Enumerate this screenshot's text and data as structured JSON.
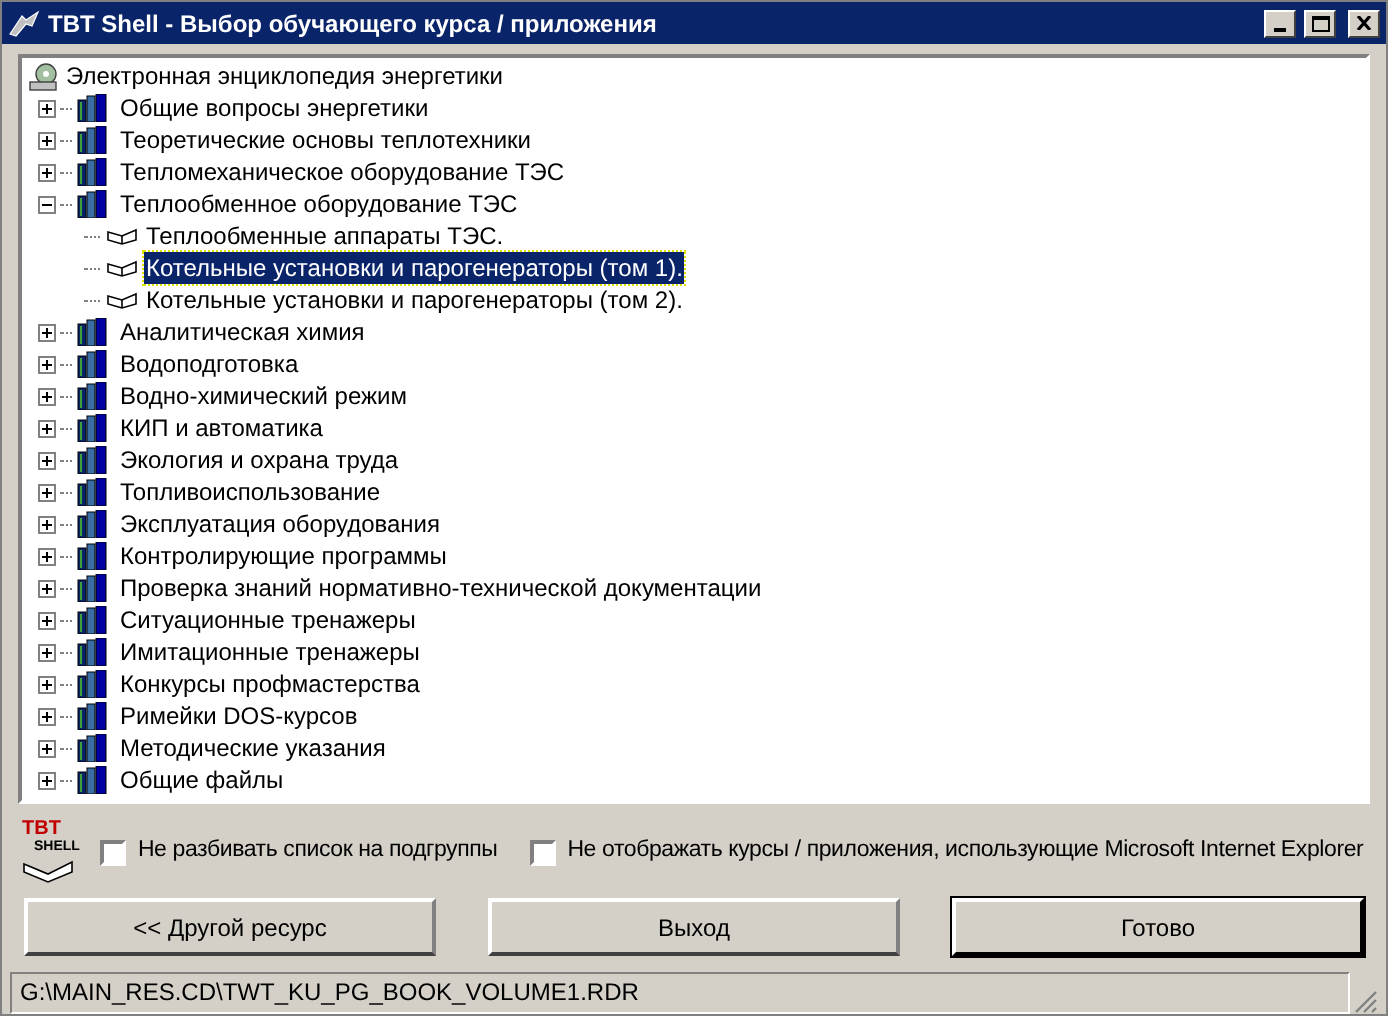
{
  "window": {
    "title": "TBT Shell - Выбор обучающего курса / приложения"
  },
  "tree": {
    "label": "Электронная энциклопедия энергетики",
    "children": [
      {
        "label": "Общие вопросы энергетики",
        "expanded": false
      },
      {
        "label": "Теоретические основы теплотехники",
        "expanded": false
      },
      {
        "label": "Тепломеханическое оборудование ТЭС",
        "expanded": false
      },
      {
        "label": "Теплообменное оборудование ТЭС",
        "expanded": true,
        "children": [
          {
            "label": "Теплообменные аппараты ТЭС.",
            "selected": false
          },
          {
            "label": "Котельные установки и парогенераторы (том 1).",
            "selected": true
          },
          {
            "label": "Котельные установки и парогенераторы (том 2).",
            "selected": false
          }
        ]
      },
      {
        "label": "Аналитическая химия",
        "expanded": false
      },
      {
        "label": "Водоподготовка",
        "expanded": false
      },
      {
        "label": "Водно-химический режим",
        "expanded": false
      },
      {
        "label": "КИП и автоматика",
        "expanded": false
      },
      {
        "label": "Экология и охрана труда",
        "expanded": false
      },
      {
        "label": "Топливоиспользование",
        "expanded": false
      },
      {
        "label": "Эксплуатация оборудования",
        "expanded": false
      },
      {
        "label": "Контролирующие программы",
        "expanded": false
      },
      {
        "label": "Проверка знаний нормативно-технической документации",
        "expanded": false
      },
      {
        "label": "Ситуационные тренажеры",
        "expanded": false
      },
      {
        "label": "Имитационные тренажеры",
        "expanded": false
      },
      {
        "label": "Конкурсы профмастерства",
        "expanded": false
      },
      {
        "label": "Римейки DOS-курсов",
        "expanded": false
      },
      {
        "label": "Методические указания",
        "expanded": false
      },
      {
        "label": "Общие файлы",
        "expanded": false
      }
    ]
  },
  "logo": {
    "line1": "TBT",
    "line2": "SHELL"
  },
  "options": [
    {
      "label": "Не разбивать список на подгруппы",
      "checked": false
    },
    {
      "label": "Не отображать курсы / приложения, использующие Microsoft Internet Explorer",
      "checked": false
    }
  ],
  "buttons": [
    {
      "label": "<< Другой ресурс",
      "default": false
    },
    {
      "label": "Выход",
      "default": false
    },
    {
      "label": "Готово",
      "default": true
    }
  ],
  "status_bar": "G:\\MAIN_RES.CD\\TWT_KU_PG_BOOK_VOLUME1.RDR"
}
